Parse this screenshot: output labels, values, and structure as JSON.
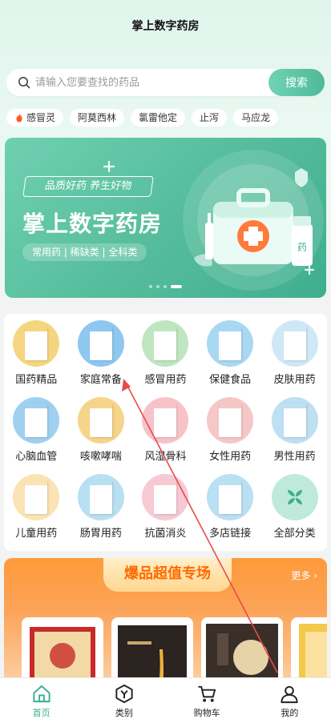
{
  "header": {
    "title": "掌上数字药房"
  },
  "search": {
    "placeholder": "请输入您要查找的药品",
    "button_label": "搜索"
  },
  "hot_tags": [
    "感冒灵",
    "阿莫西林",
    "氯雷他定",
    "止泻",
    "马应龙"
  ],
  "banner": {
    "ribbon": "品质好药 养生好物",
    "title": "掌上数字药房",
    "subtitle": "常用药 | 稀缺类 | 全科类",
    "art_label": "药",
    "slide_count": 4,
    "active_slide": 4
  },
  "categories": [
    {
      "label": "国药精品",
      "icon": "ginseng-gift-box-icon",
      "color": "#f5d680"
    },
    {
      "label": "家庭常备",
      "icon": "medicine-box-icon",
      "color": "#8ec7f0"
    },
    {
      "label": "感冒用药",
      "icon": "cold-medicine-icon",
      "color": "#bfe6c0"
    },
    {
      "label": "保健食品",
      "icon": "health-food-icon",
      "color": "#a9d8f2"
    },
    {
      "label": "皮肤用药",
      "icon": "skin-medicine-icon",
      "color": "#cfe8f5"
    },
    {
      "label": "心脑血管",
      "icon": "cardio-medicine-icon",
      "color": "#9fd0f0"
    },
    {
      "label": "咳嗽哮喘",
      "icon": "cough-medicine-icon",
      "color": "#f6d489"
    },
    {
      "label": "风湿骨科",
      "icon": "rheumatism-medicine-icon",
      "color": "#f7c3c9"
    },
    {
      "label": "女性用药",
      "icon": "female-medicine-icon",
      "color": "#f6c7c7"
    },
    {
      "label": "男性用药",
      "icon": "male-medicine-icon",
      "color": "#bfdff2"
    },
    {
      "label": "儿童用药",
      "icon": "child-medicine-icon",
      "color": "#fbe3b3"
    },
    {
      "label": "肠胃用药",
      "icon": "stomach-medicine-icon",
      "color": "#b9dff2"
    },
    {
      "label": "抗菌消炎",
      "icon": "antibacterial-medicine-icon",
      "color": "#f6c9d3"
    },
    {
      "label": "多店链接",
      "icon": "multi-store-icon",
      "color": "#b9e0f3"
    },
    {
      "label": "全部分类",
      "icon": "all-categories-icon",
      "color": "#bfeadb"
    }
  ],
  "promo": {
    "title": "爆品超值专场",
    "more_label": "更多"
  },
  "tabbar": [
    {
      "label": "首页",
      "icon": "home-icon",
      "active": true
    },
    {
      "label": "类别",
      "icon": "category-icon",
      "active": false
    },
    {
      "label": "购物车",
      "icon": "cart-icon",
      "active": false
    },
    {
      "label": "我的",
      "icon": "profile-icon",
      "active": false
    }
  ],
  "colors": {
    "accent": "#4fb998",
    "promo_orange": "#ff9a3a",
    "annotation_red": "#e84a4a"
  }
}
